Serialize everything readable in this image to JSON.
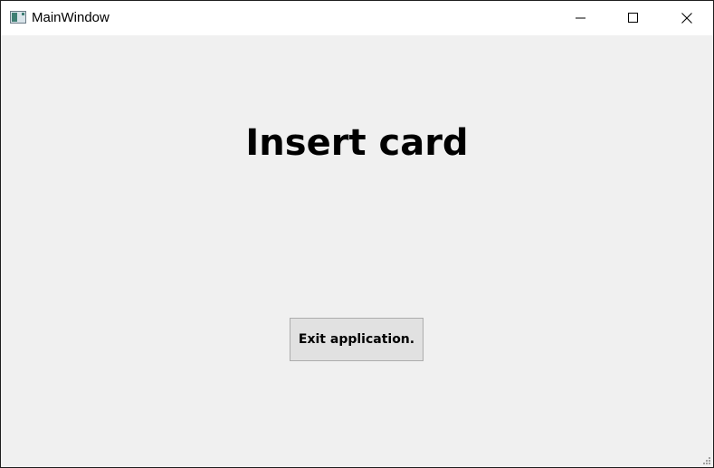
{
  "window": {
    "title": "MainWindow",
    "controls": {
      "minimize_icon": "minimize-icon",
      "maximize_icon": "maximize-icon",
      "close_icon": "close-icon"
    }
  },
  "main": {
    "heading": "Insert card",
    "exit_button_label": "Exit application."
  },
  "colors": {
    "background": "#f0f0f0",
    "titlebar": "#ffffff",
    "button_face": "#e1e1e1",
    "button_border": "#adadad"
  }
}
